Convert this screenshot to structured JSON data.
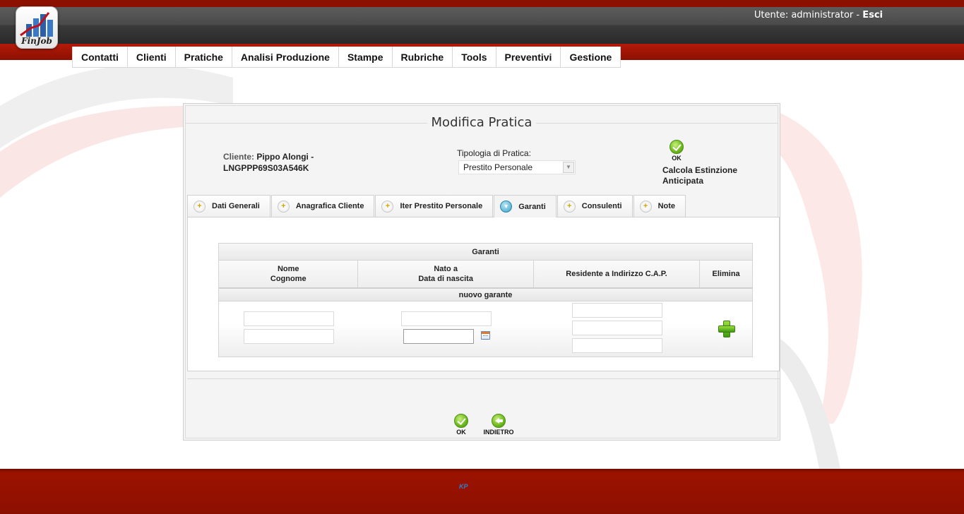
{
  "app": {
    "logo_text": "FinJob"
  },
  "header": {
    "user_prefix": "Utente: administrator - ",
    "logout_label": "Esci"
  },
  "menu": {
    "items": [
      "Contatti",
      "Clienti",
      "Pratiche",
      "Analisi Produzione",
      "Stampe",
      "Rubriche",
      "Tools",
      "Preventivi",
      "Gestione"
    ]
  },
  "form": {
    "title": "Modifica Pratica",
    "client_label": "Cliente: ",
    "client_name": "Pippo Alongi - LNGPPP69S03A546K",
    "tipologia_label": "Tipologia di Pratica:",
    "tipologia_value": "Prestito Personale",
    "ok_top_caption": "OK",
    "calc_label": "Calcola Estinzione Anticipata"
  },
  "tabs": [
    {
      "label": "Dati Generali",
      "active": false
    },
    {
      "label": "Anagrafica Cliente",
      "active": false
    },
    {
      "label": "Iter Prestito Personale",
      "active": false
    },
    {
      "label": "Garanti",
      "active": true
    },
    {
      "label": "Consulenti",
      "active": false
    },
    {
      "label": "Note",
      "active": false
    }
  ],
  "garanti": {
    "title": "Garanti",
    "col_nome": "Nome",
    "col_cognome": "Cognome",
    "col_nato": "Nato a",
    "col_data": "Data di nascita",
    "col_residente": "Residente a Indirizzo C.A.P.",
    "col_elimina": "Elimina",
    "new_row_label": "nuovo garante",
    "inputs": {
      "nome": "",
      "cognome": "",
      "nato_a": "",
      "data_nascita": "",
      "residente": "",
      "indirizzo": "",
      "cap": ""
    }
  },
  "bottom": {
    "ok_caption": "OK",
    "back_caption": "INDIETRO"
  },
  "footer": {
    "logo_text": "KP"
  },
  "colors": {
    "brand_red": "#8c1000",
    "header_dark": "#3a3a3a",
    "accent_green": "#6cb81c"
  }
}
